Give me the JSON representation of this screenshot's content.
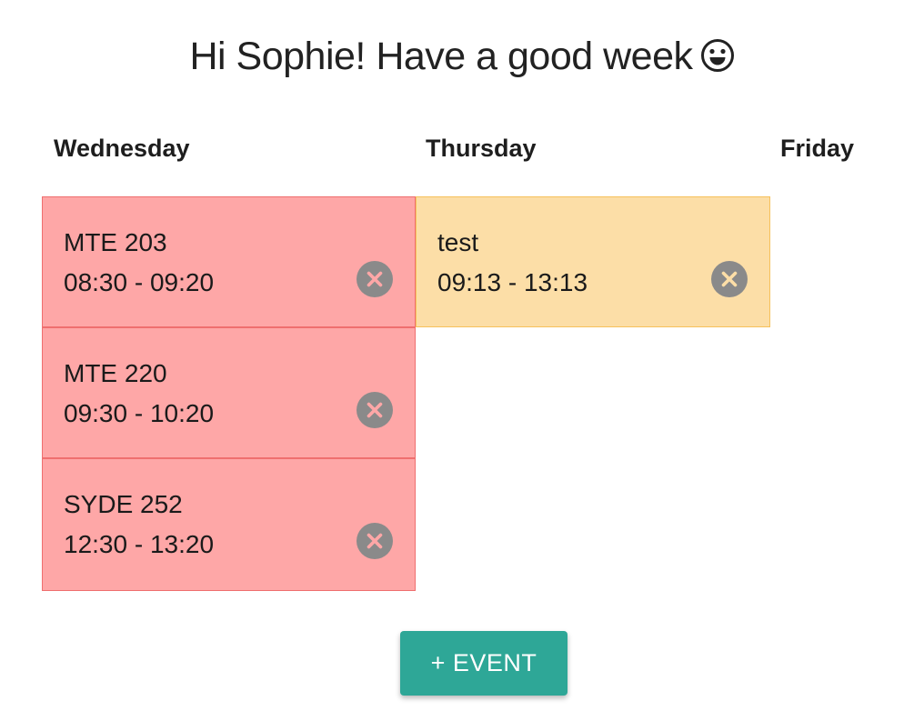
{
  "greeting": {
    "text": "Hi Sophie! Have a good week",
    "icon": "smiley-icon"
  },
  "days": [
    {
      "name": "Wednesday",
      "color": "#fea7a7",
      "events": [
        {
          "title": "MTE 203",
          "time": "08:30 - 09:20"
        },
        {
          "title": "MTE 220",
          "time": "09:30 - 10:20"
        },
        {
          "title": "SYDE 252",
          "time": "12:30 - 13:20"
        }
      ]
    },
    {
      "name": "Thursday",
      "color": "#fcdea7",
      "events": [
        {
          "title": "test",
          "time": "09:13 - 13:13"
        }
      ]
    },
    {
      "name": "Friday",
      "events": []
    }
  ],
  "actions": {
    "add_event_label": "+ EVENT",
    "accent_color": "#2ea797",
    "remove_icon": "close-circle-icon"
  }
}
